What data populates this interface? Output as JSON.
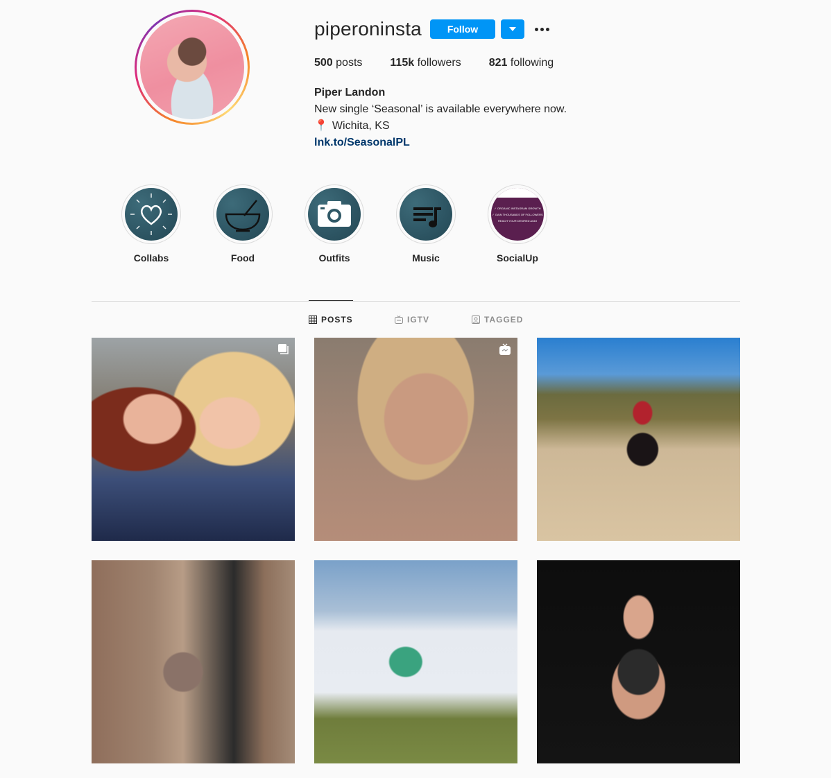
{
  "profile": {
    "username": "piperoninsta",
    "follow_label": "Follow",
    "stats": {
      "posts_count": "500",
      "posts_label": "posts",
      "followers_count": "115k",
      "followers_label": "followers",
      "following_count": "821",
      "following_label": "following"
    },
    "full_name": "Piper Landon",
    "bio_line": "New single ‘Seasonal’ is available everywhere now.",
    "location": "Wichita, KS",
    "location_icon": "📍",
    "link": "lnk.to/SeasonalPL"
  },
  "highlights": [
    {
      "label": "Collabs",
      "icon": "heart-icon"
    },
    {
      "label": "Food",
      "icon": "bowl-icon"
    },
    {
      "label": "Outfits",
      "icon": "camera-icon"
    },
    {
      "label": "Music",
      "icon": "music-icon"
    },
    {
      "label": "SocialUp",
      "icon": "socialup-thumbnail",
      "lines": [
        "✓ ORGANIC INSTAGRAM GROWTH",
        "✓ GAIN THOUSANDS OF FOLLOWERS",
        "REACH YOUR DESIRED AUDI"
      ]
    }
  ],
  "tabs": [
    {
      "label": "POSTS",
      "icon": "grid-icon",
      "active": true
    },
    {
      "label": "IGTV",
      "icon": "igtv-icon",
      "active": false
    },
    {
      "label": "TAGGED",
      "icon": "tag-icon",
      "active": false
    }
  ],
  "posts": [
    {
      "badge": "multiple-icon"
    },
    {
      "badge": "igtv-icon"
    },
    {
      "badge": null
    },
    {
      "badge": null
    },
    {
      "badge": null
    },
    {
      "badge": null
    }
  ],
  "colors": {
    "accent": "#0095f6",
    "link": "#00376b",
    "background": "#fafafa",
    "text": "#262626",
    "muted": "#8e8e8e"
  }
}
